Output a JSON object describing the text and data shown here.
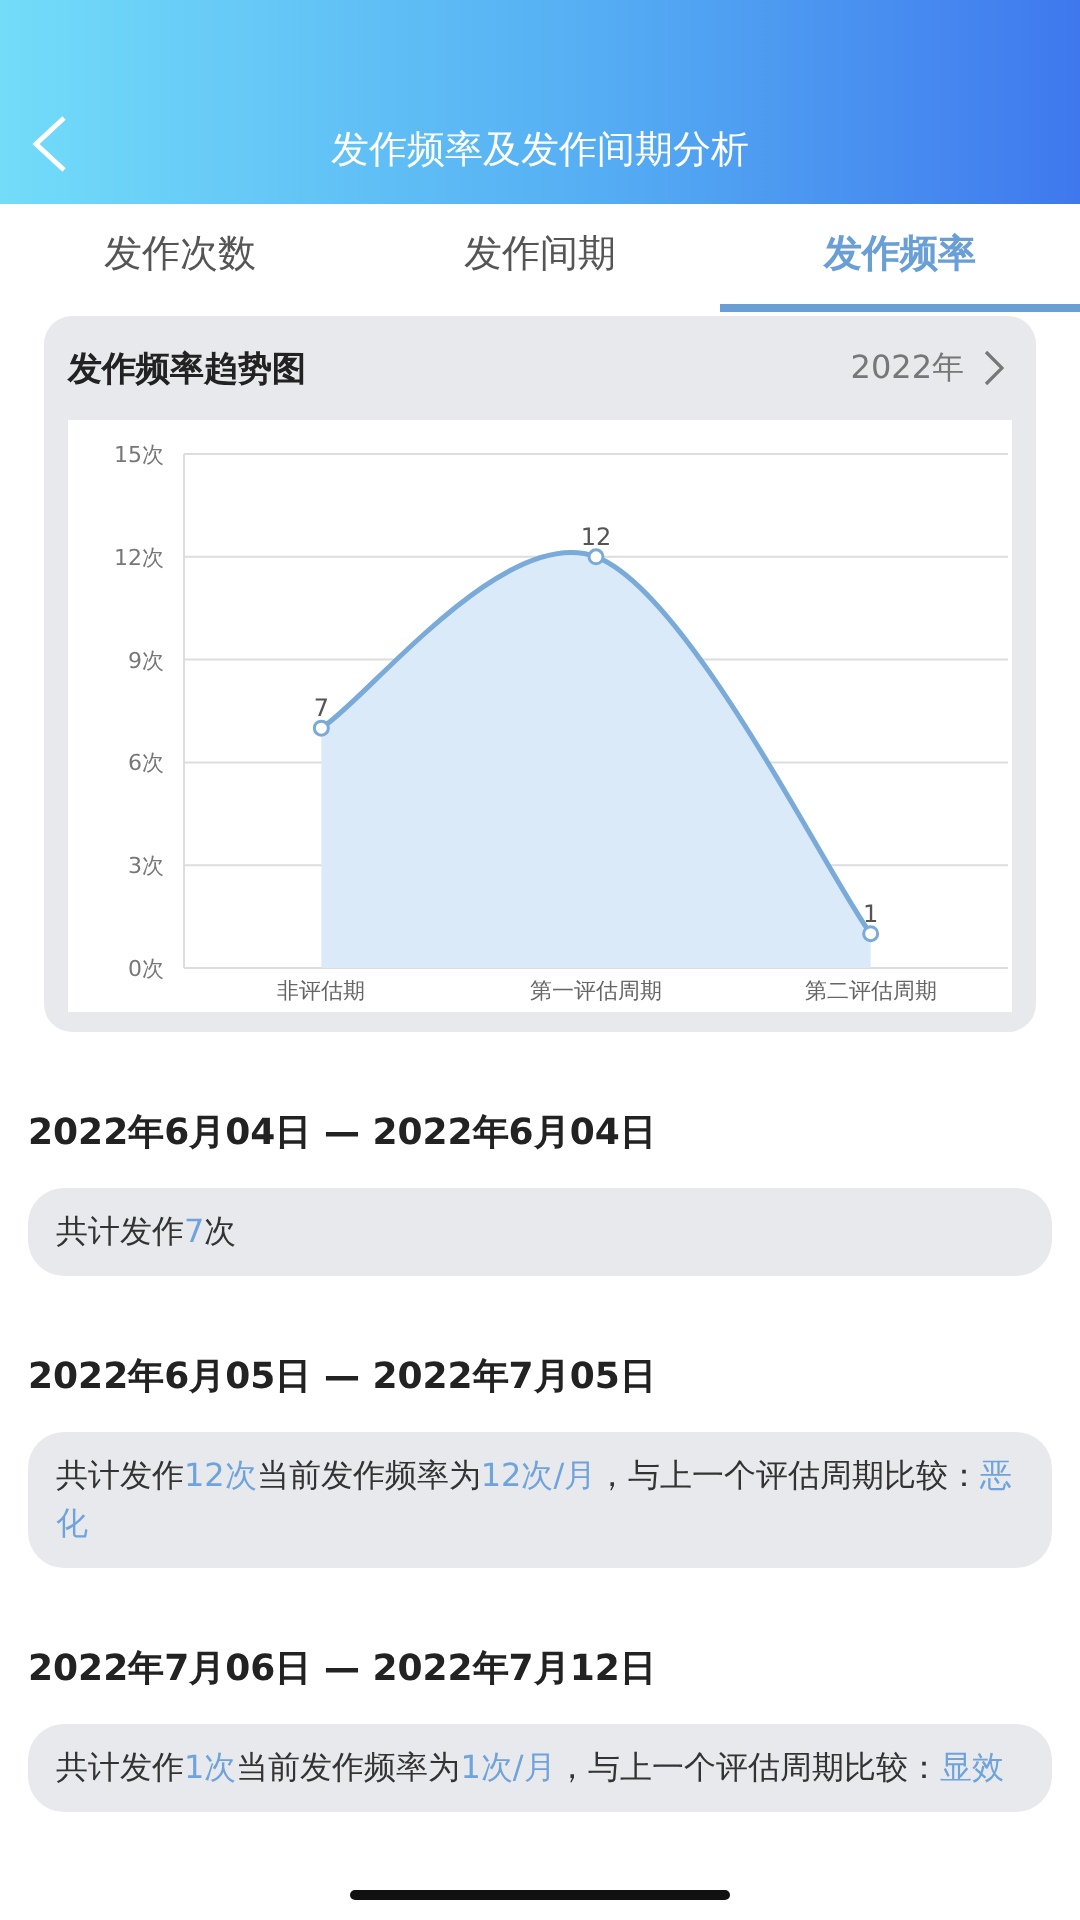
{
  "header": {
    "title": "发作频率及发作间期分析"
  },
  "tabs": [
    {
      "label": "发作次数",
      "selected": false
    },
    {
      "label": "发作间期",
      "selected": false
    },
    {
      "label": "发作频率",
      "selected": true
    }
  ],
  "chart_card": {
    "title": "发作频率趋势图",
    "year": "2022年",
    "chart_data": {
      "type": "area",
      "categories": [
        "非评估期",
        "第一评估周期",
        "第二评估周期"
      ],
      "series": [
        {
          "color": "#7aaad8",
          "values": [
            7,
            12,
            1
          ]
        }
      ],
      "grid": true,
      "ylim": [
        0,
        15
      ],
      "yticks": [
        {
          "value": 0,
          "label": "0次"
        },
        {
          "value": 3,
          "label": "3次"
        },
        {
          "value": 6,
          "label": "6次"
        },
        {
          "value": 9,
          "label": "9次"
        },
        {
          "value": 12,
          "label": "12次"
        },
        {
          "value": 15,
          "label": "15次"
        }
      ],
      "data_labels": true
    }
  },
  "periods": [
    {
      "range": "2022年6月04日 — 2022年6月04日",
      "summary": [
        {
          "text": "共计发作",
          "highlight": false
        },
        {
          "text": "7",
          "highlight": true
        },
        {
          "text": "次",
          "highlight": false
        }
      ]
    },
    {
      "range": "2022年6月05日 — 2022年7月05日",
      "summary": [
        {
          "text": "共计发作",
          "highlight": false
        },
        {
          "text": "12次",
          "highlight": true
        },
        {
          "text": "当前发作频率为",
          "highlight": false
        },
        {
          "text": "12次/月",
          "highlight": true
        },
        {
          "text": "，与上一个评估周期比较：",
          "highlight": false
        },
        {
          "text": "恶化",
          "highlight": true
        }
      ]
    },
    {
      "range": "2022年7月06日 — 2022年7月12日",
      "summary": [
        {
          "text": "共计发作",
          "highlight": false
        },
        {
          "text": "1次",
          "highlight": true
        },
        {
          "text": "当前发作频率为",
          "highlight": false
        },
        {
          "text": "1次/月",
          "highlight": true
        },
        {
          "text": "，与上一个评估周期比较：",
          "highlight": false
        },
        {
          "text": "显效",
          "highlight": true
        }
      ]
    }
  ]
}
